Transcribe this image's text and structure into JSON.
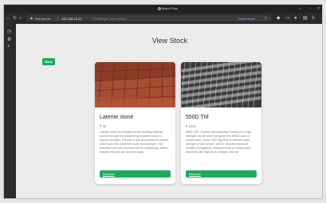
{
  "browser": {
    "window_title": "Brave-Plan",
    "security_label": "Not secure",
    "url_host": "192.168.18.20",
    "url_path": "/STB/buyer_view_stock",
    "mode_label": "Guest mode"
  },
  "page": {
    "title": "View Stock",
    "back_label": "Back"
  },
  "products": [
    {
      "name": "Laterite stone",
      "price": "₹ 32",
      "description": "Laterite stone is a reddish-brown building material formed through the weathering of parent rocks in tropical climates. It is rich in iron and aluminum oxides, which give it its distinctive color and strength. The formation process involves intense weathering, where soluble minerals are leached away",
      "remove_label": "Remove"
    },
    {
      "name": "550D TM",
      "price": "₹ 1024",
      "description": "550D TMT (Thermo Mechanically Treated) is a high-strength, ductile steel bar grade (Fe 550D) used in construction, where '550' signifies a minimum yield strength of 550 N/mm², and 'D' denotes improved ductility (elongation), making it ideal for heavy-load structures like high-rises, bridges, and we",
      "remove_label": "Remove"
    }
  ],
  "colors": {
    "accent_green": "#1cab5b",
    "browser_chrome": "#2b2b2b",
    "page_background": "#ececec"
  }
}
